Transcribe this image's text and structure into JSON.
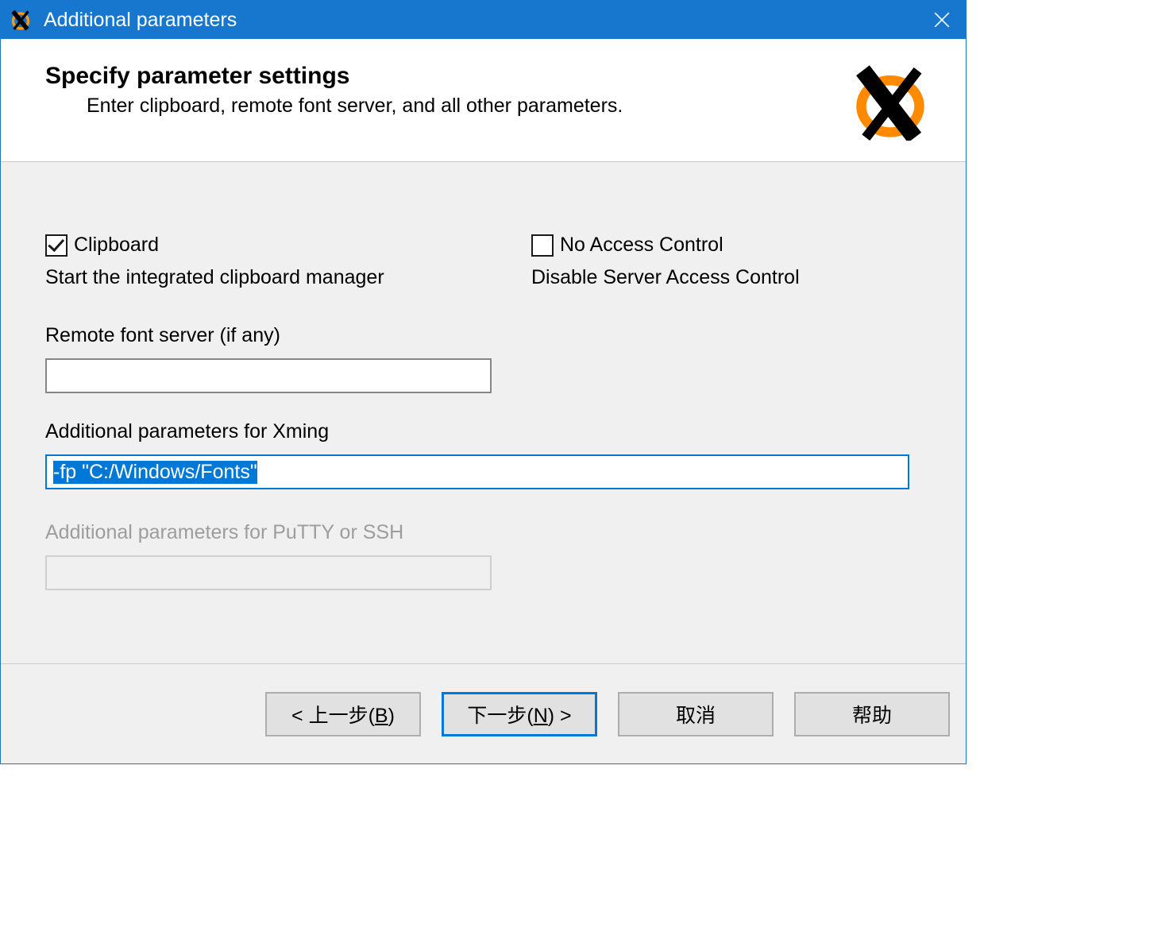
{
  "titlebar": {
    "title": "Additional parameters"
  },
  "header": {
    "heading": "Specify parameter settings",
    "sub": "Enter clipboard, remote font server, and all other parameters."
  },
  "content": {
    "clipboard_label": "Clipboard",
    "clipboard_checked": true,
    "clipboard_desc": "Start the integrated clipboard manager",
    "noaccess_label": "No Access Control",
    "noaccess_checked": false,
    "noaccess_desc": "Disable Server Access Control",
    "remote_font_label": "Remote font server (if any)",
    "remote_font_value": "",
    "xming_params_label": "Additional parameters for Xming",
    "xming_params_value": "-fp \"C:/Windows/Fonts\"",
    "putty_params_label": "Additional parameters for PuTTY or SSH",
    "putty_params_value": ""
  },
  "footer": {
    "back_prefix": "< 上一步(",
    "back_mn": "B",
    "back_suffix": ")",
    "next_prefix": "下一步(",
    "next_mn": "N",
    "next_suffix": ") >",
    "cancel": "取消",
    "help": "帮助"
  }
}
